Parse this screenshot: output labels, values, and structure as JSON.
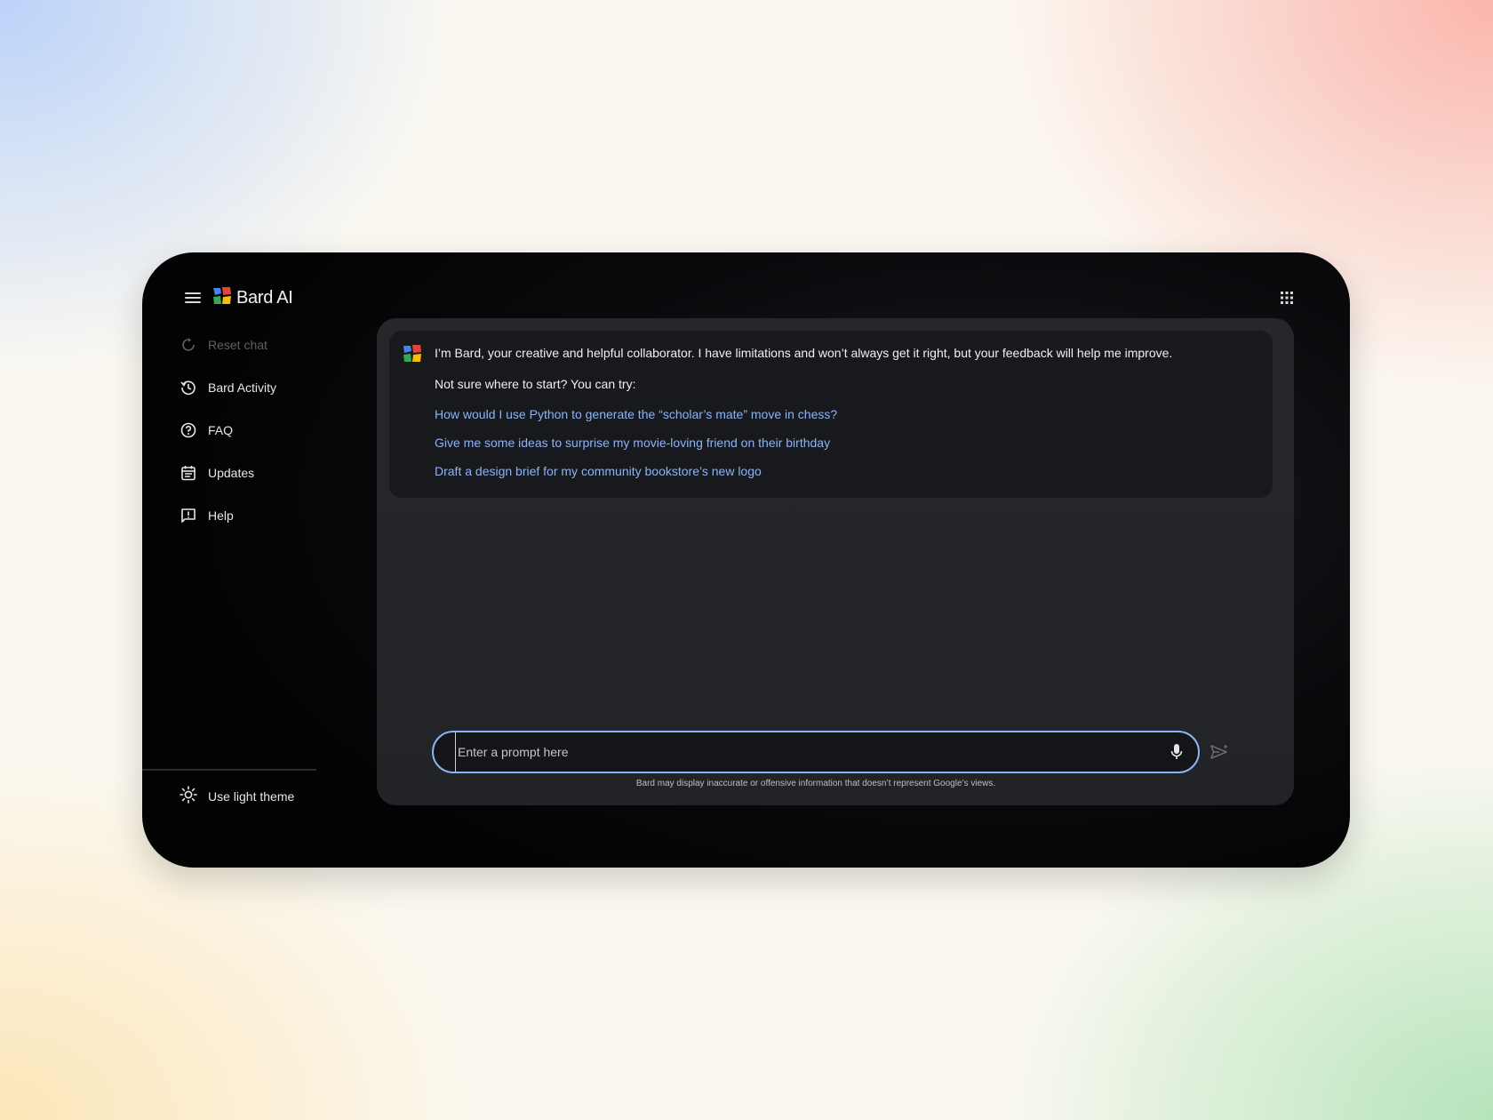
{
  "app": {
    "title": "Bard AI",
    "icons": {
      "menu": "hamburger-menu-icon",
      "logo": "bard-logo-icon",
      "apps": "apps-grid-icon"
    }
  },
  "sidebar": {
    "items": [
      {
        "label": "Reset chat",
        "icon": "reset-icon",
        "disabled": true
      },
      {
        "label": "Bard Activity",
        "icon": "history-icon"
      },
      {
        "label": "FAQ",
        "icon": "help-circle-icon"
      },
      {
        "label": "Updates",
        "icon": "calendar-icon"
      },
      {
        "label": "Help",
        "icon": "feedback-icon"
      }
    ],
    "theme_label": "Use light theme",
    "theme_icon": "sun-icon"
  },
  "chat": {
    "intro": "I’m Bard, your creative and helpful collaborator. I have limitations and won’t always get it right, but your feedback will help me improve.",
    "hint": "Not sure where to start? You can try:",
    "suggestions": [
      "How would I use Python to generate the “scholar’s mate” move in chess?",
      "Give me some ideas to surprise my movie-loving friend on their birthday",
      "Draft a design brief for my community bookstore’s new logo"
    ]
  },
  "prompt": {
    "placeholder": "Enter a prompt here",
    "mic_icon": "mic-icon",
    "send_icon": "send-icon"
  },
  "disclaimer": "Bard may display inaccurate or offensive information that doesn’t represent Google’s views.",
  "colors": {
    "accent": "#8ab4f8",
    "logo_blue": "#4285f4",
    "logo_red": "#ea4335",
    "logo_yellow": "#fbbc04",
    "logo_green": "#34a853"
  }
}
